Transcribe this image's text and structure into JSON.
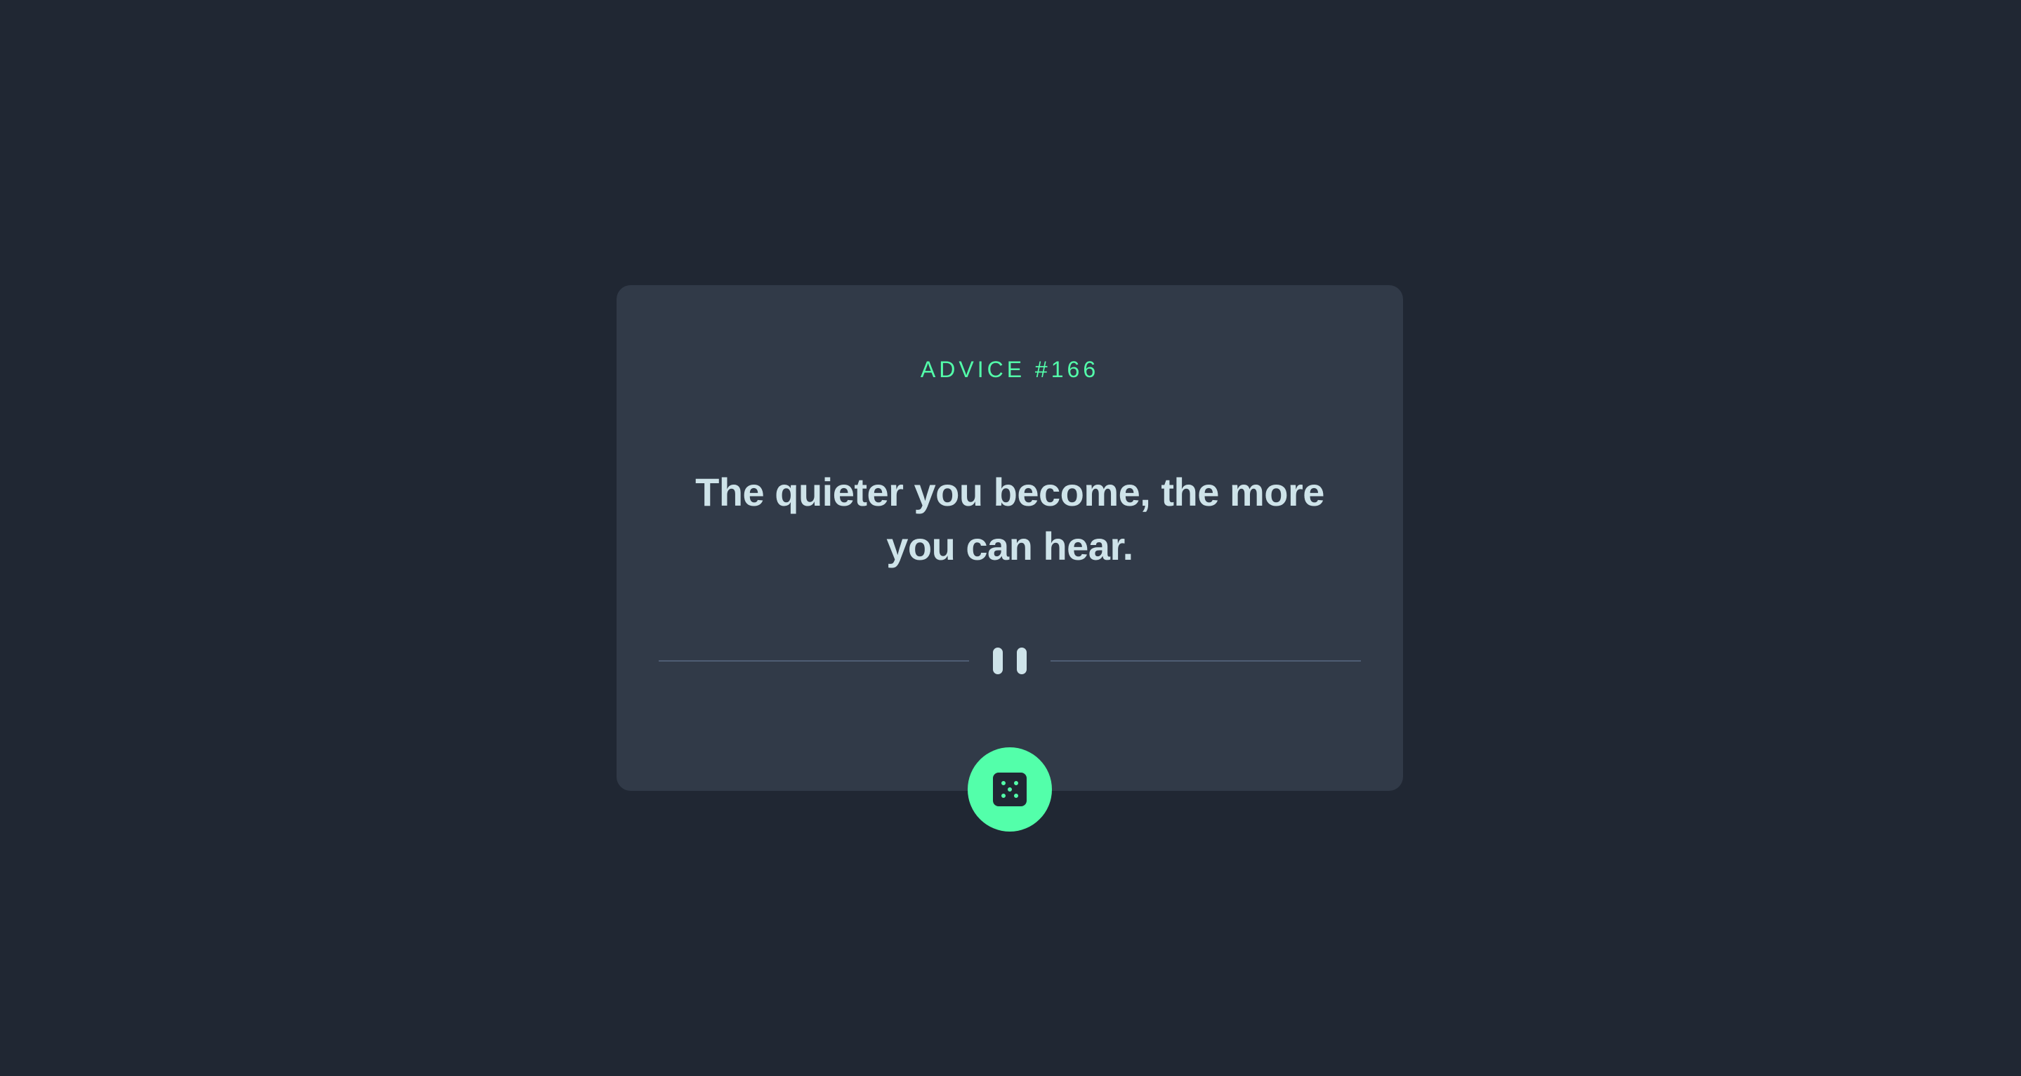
{
  "card": {
    "label": "ADVICE #166",
    "quote": "The quieter you become, the more you can hear."
  },
  "button": {
    "icon": "dice-icon",
    "aria_label": "Generate new advice"
  },
  "colors": {
    "page_background": "#202733",
    "card_background": "#313A48",
    "accent": "#53FFAA",
    "quote_text": "#CEE3E9",
    "divider": "#4F5D74"
  }
}
